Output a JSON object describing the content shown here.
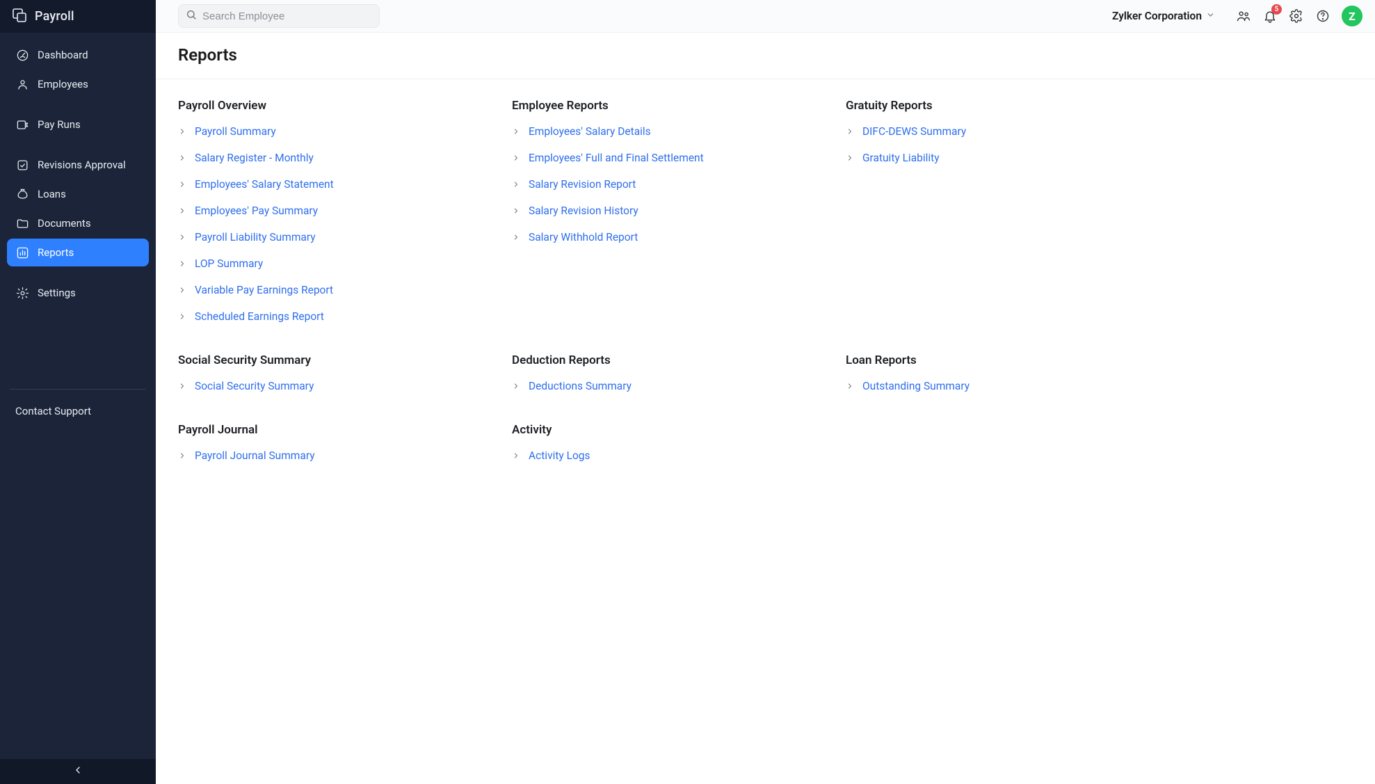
{
  "brand": {
    "title": "Payroll"
  },
  "sidebar": {
    "items": [
      {
        "key": "dashboard",
        "label": "Dashboard",
        "icon": "gauge-icon"
      },
      {
        "key": "employees",
        "label": "Employees",
        "icon": "person-icon"
      },
      {
        "key": "payruns",
        "label": "Pay Runs",
        "icon": "payrun-icon",
        "gap_before": true
      },
      {
        "key": "revisions-approval",
        "label": "Revisions Approval",
        "icon": "check-square-icon",
        "gap_before": true
      },
      {
        "key": "loans",
        "label": "Loans",
        "icon": "moneybag-icon"
      },
      {
        "key": "documents",
        "label": "Documents",
        "icon": "folder-icon"
      },
      {
        "key": "reports",
        "label": "Reports",
        "icon": "barchart-icon",
        "active": true
      },
      {
        "key": "settings",
        "label": "Settings",
        "icon": "gear-icon",
        "gap_before": true
      }
    ],
    "support_label": "Contact Support"
  },
  "search": {
    "placeholder": "Search Employee"
  },
  "org": {
    "name": "Zylker Corporation"
  },
  "notifications": {
    "count": "5"
  },
  "avatar": {
    "letter": "Z",
    "bg": "#22c55e"
  },
  "page": {
    "title": "Reports"
  },
  "sections": [
    {
      "key": "payroll-overview",
      "title": "Payroll Overview",
      "items": [
        "Payroll Summary",
        "Salary Register - Monthly",
        "Employees' Salary Statement",
        "Employees' Pay Summary",
        "Payroll Liability Summary",
        "LOP Summary",
        "Variable Pay Earnings Report",
        "Scheduled Earnings Report"
      ]
    },
    {
      "key": "employee-reports",
      "title": "Employee Reports",
      "items": [
        "Employees' Salary Details",
        "Employees' Full and Final Settlement",
        "Salary Revision Report",
        "Salary Revision History",
        "Salary Withhold Report"
      ]
    },
    {
      "key": "gratuity-reports",
      "title": "Gratuity Reports",
      "items": [
        "DIFC-DEWS Summary",
        "Gratuity Liability"
      ]
    },
    {
      "key": "social-security",
      "title": "Social Security Summary",
      "items": [
        "Social Security Summary"
      ]
    },
    {
      "key": "deduction-reports",
      "title": "Deduction Reports",
      "items": [
        "Deductions Summary"
      ]
    },
    {
      "key": "loan-reports",
      "title": "Loan Reports",
      "items": [
        "Outstanding Summary"
      ]
    },
    {
      "key": "payroll-journal",
      "title": "Payroll Journal",
      "items": [
        "Payroll Journal Summary"
      ]
    },
    {
      "key": "activity",
      "title": "Activity",
      "items": [
        "Activity Logs"
      ]
    }
  ]
}
